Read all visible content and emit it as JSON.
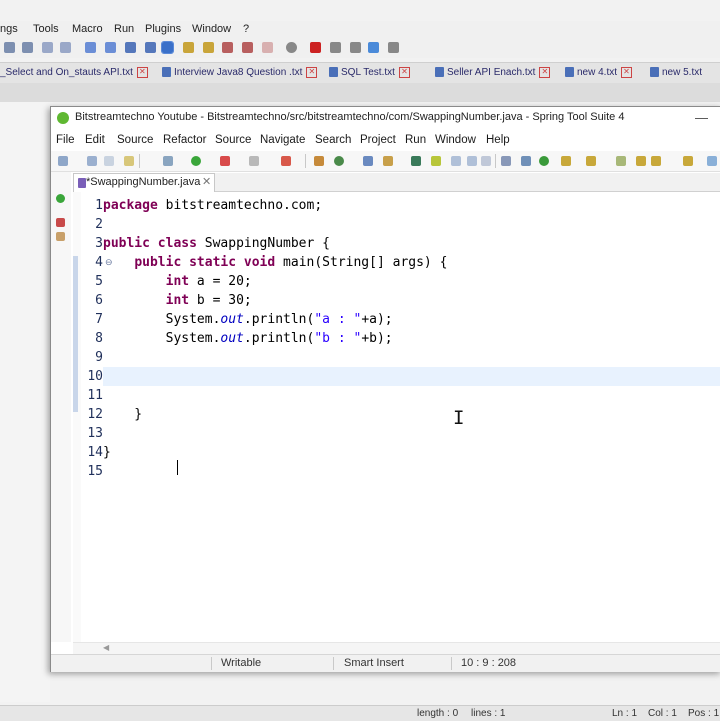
{
  "np": {
    "menu": [
      "ngs",
      "Tools",
      "Macro",
      "Run",
      "Plugins",
      "Window",
      "?"
    ],
    "tabs": [
      "_Select and On_stauts API.txt",
      "Interview Java8 Question .txt",
      "SQL Test.txt",
      "Seller API Enach.txt",
      "new 4.txt",
      "new 5.txt"
    ],
    "status": {
      "length": "length : 0",
      "lines": "lines : 1",
      "ln": "Ln : 1",
      "col": "Col : 1",
      "pos": "Pos : 1"
    }
  },
  "sts": {
    "title": "Bitstreamtechno Youtube - Bitstreamtechno/src/bitstreamtechno/com/SwappingNumber.java - Spring Tool Suite 4",
    "minimize": "—",
    "menu": [
      "File",
      "Edit",
      "Source",
      "Refactor",
      "Source",
      "Navigate",
      "Search",
      "Project",
      "Run",
      "Window",
      "Help"
    ],
    "tab_label": "*SwappingNumber.java",
    "tab_close": "✕",
    "status": {
      "writable": "Writable",
      "insert": "Smart Insert",
      "position": "10 : 9 : 208"
    },
    "scroll_arrow": "◀"
  },
  "editor": {
    "line_numbers": [
      "1",
      "2",
      "3",
      "4",
      "5",
      "6",
      "7",
      "8",
      "9",
      "10",
      "11",
      "12",
      "13",
      "14",
      "15"
    ],
    "fold_marker": "⊖",
    "current_line": 10,
    "lines": [
      [
        {
          "t": "kw",
          "s": "package"
        },
        {
          "t": "",
          "s": " bitstreamtechno.com;"
        }
      ],
      [],
      [
        {
          "t": "kw",
          "s": "public"
        },
        {
          "t": "",
          "s": " "
        },
        {
          "t": "kw",
          "s": "class"
        },
        {
          "t": "",
          "s": " SwappingNumber {"
        }
      ],
      [
        {
          "t": "",
          "s": "    "
        },
        {
          "t": "kw",
          "s": "public"
        },
        {
          "t": "",
          "s": " "
        },
        {
          "t": "kw",
          "s": "static"
        },
        {
          "t": "",
          "s": " "
        },
        {
          "t": "kw",
          "s": "void"
        },
        {
          "t": "",
          "s": " main(String[] args) {"
        }
      ],
      [
        {
          "t": "",
          "s": "        "
        },
        {
          "t": "kw",
          "s": "int"
        },
        {
          "t": "",
          "s": " a = 20;"
        }
      ],
      [
        {
          "t": "",
          "s": "        "
        },
        {
          "t": "kw",
          "s": "int"
        },
        {
          "t": "",
          "s": " b = 30;"
        }
      ],
      [
        {
          "t": "",
          "s": "        System."
        },
        {
          "t": "fld",
          "s": "out"
        },
        {
          "t": "",
          "s": ".println("
        },
        {
          "t": "str",
          "s": "\"a : \""
        },
        {
          "t": "",
          "s": "+a);"
        }
      ],
      [
        {
          "t": "",
          "s": "        System."
        },
        {
          "t": "fld",
          "s": "out"
        },
        {
          "t": "",
          "s": ".println("
        },
        {
          "t": "str",
          "s": "\"b : \""
        },
        {
          "t": "",
          "s": "+b);"
        }
      ],
      [],
      [],
      [],
      [
        {
          "t": "",
          "s": "    }"
        }
      ],
      [],
      [
        {
          "t": "",
          "s": "}"
        }
      ],
      []
    ]
  }
}
